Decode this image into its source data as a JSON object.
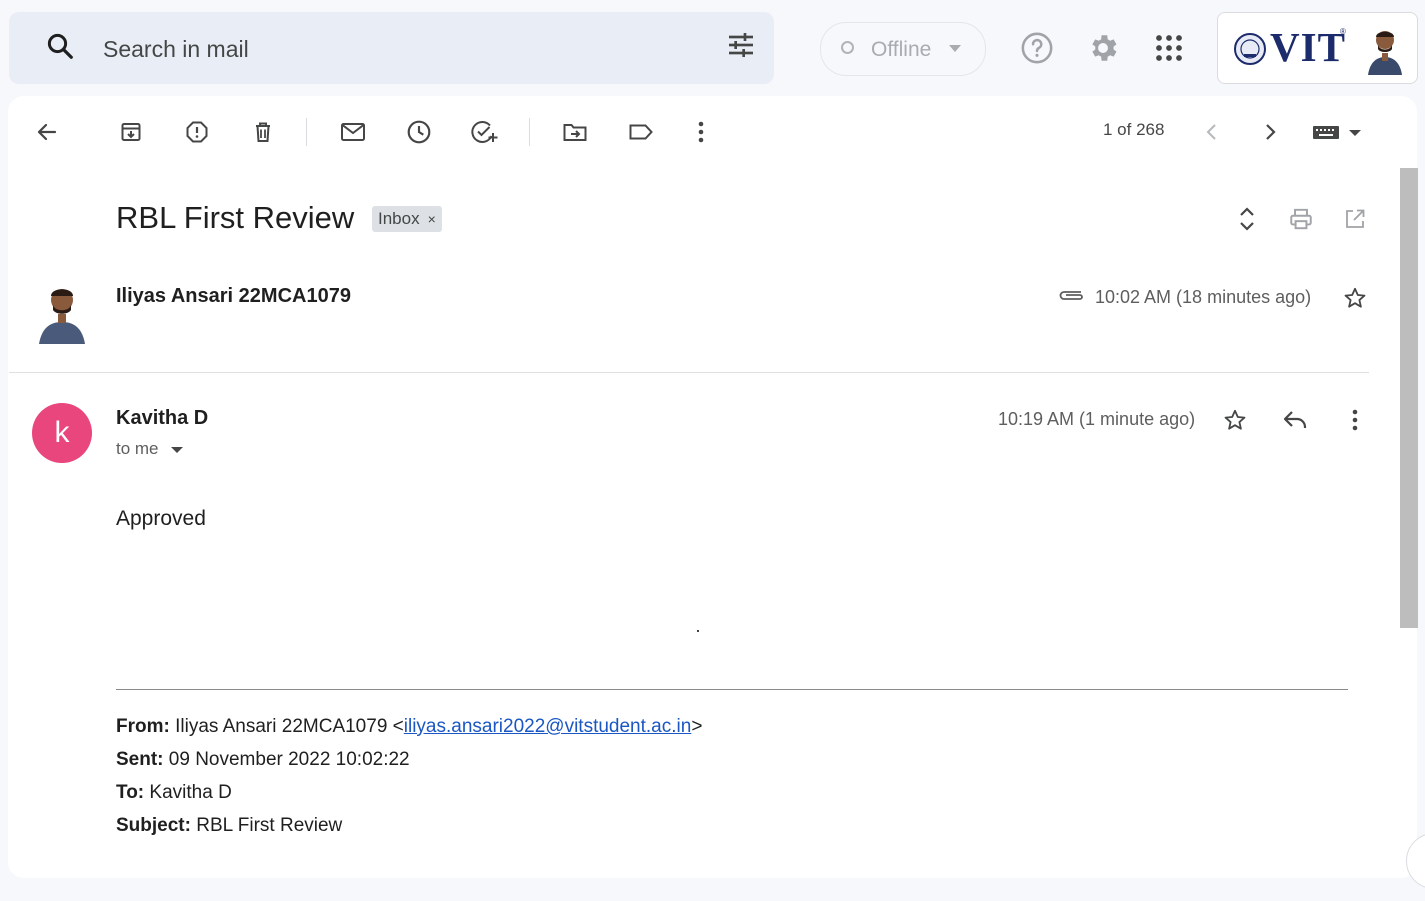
{
  "search": {
    "placeholder": "Search in mail"
  },
  "status": {
    "label": "Offline"
  },
  "account": {
    "org_logo_text": "VIT",
    "org_logo_reg": "®"
  },
  "toolbar": {
    "pager": "1 of 268"
  },
  "thread": {
    "subject": "RBL First Review",
    "label_chip": "Inbox",
    "label_remove": "×"
  },
  "message1": {
    "sender": "Iliyas Ansari 22MCA1079",
    "time": "10:02 AM (18 minutes ago)"
  },
  "message2": {
    "avatar_letter": "k",
    "sender": "Kavitha D",
    "recipient_line": "to me",
    "time": "10:19 AM (1 minute ago)",
    "body": "Approved",
    "quoted": {
      "from_label": "From:",
      "from_name": " Iliyas Ansari 22MCA1079 <",
      "from_email": "iliyas.ansari2022@vitstudent.ac.in",
      "from_close": ">",
      "sent_label": "Sent:",
      "sent_value": " 09 November 2022 10:02:22",
      "to_label": "To:",
      "to_value": " Kavitha D",
      "subject_label": "Subject:",
      "subject_value": " RBL First Review"
    }
  },
  "colors": {
    "avatar_k": "#e8467c",
    "search_bg": "#e9eef6",
    "link": "#1a57c4"
  }
}
